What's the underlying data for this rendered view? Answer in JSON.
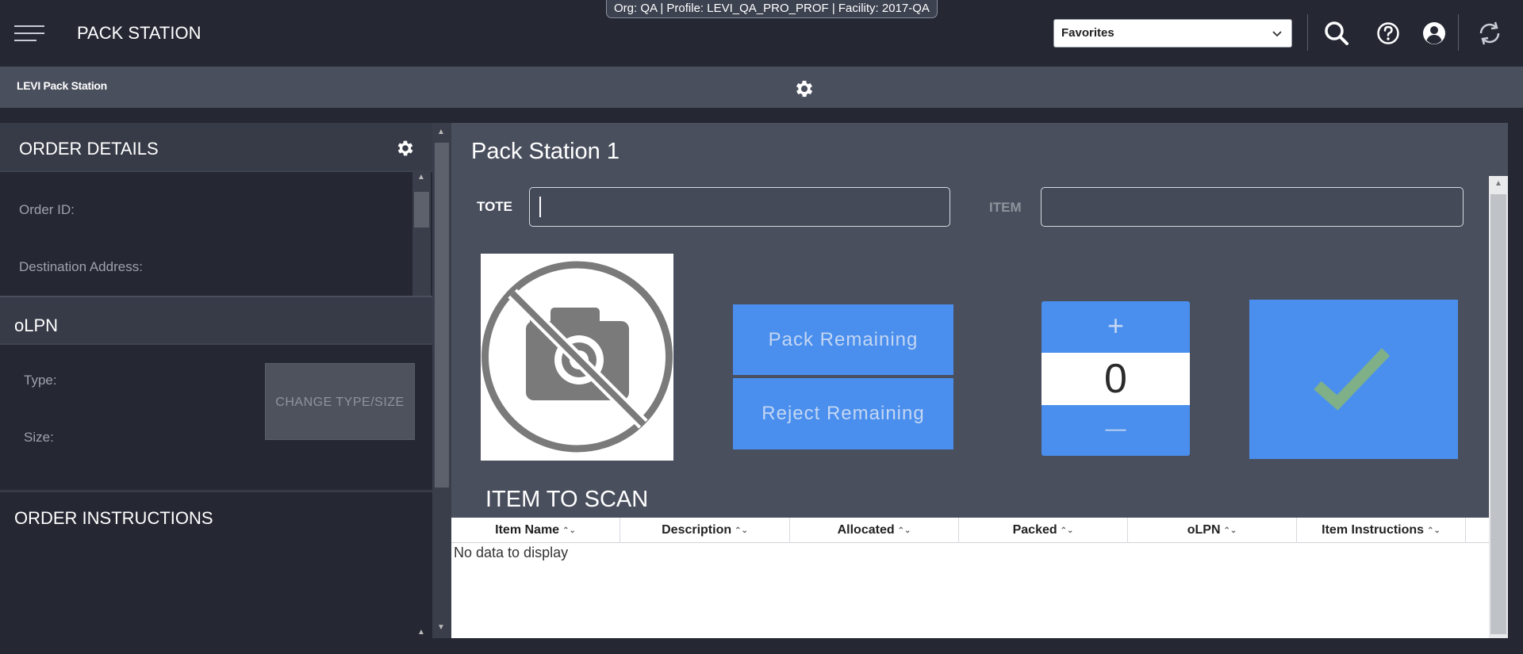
{
  "context_pill": "Org: QA  |  Profile: LEVI_QA_PRO_PROF  |  Facility: 2017-QA",
  "header": {
    "title": "PACK STATION",
    "favorites": {
      "selected": "Favorites"
    }
  },
  "subheader": {
    "title": "LEVI Pack Station"
  },
  "order_details": {
    "title": "ORDER DETAILS",
    "order_id_label": "Order ID:",
    "destination_label": "Destination Address:"
  },
  "olpn": {
    "title": "oLPN",
    "type_label": "Type:",
    "size_label": "Size:",
    "change_button": "CHANGE TYPE/SIZE"
  },
  "order_instructions": {
    "title": "ORDER INSTRUCTIONS"
  },
  "station": {
    "title": "Pack Station 1",
    "tote_label": "TOTE",
    "tote_value": "",
    "item_label": "ITEM",
    "item_value": "",
    "pack_remaining": "Pack Remaining",
    "reject_remaining": "Reject Remaining",
    "quantity": "0",
    "plus": "+",
    "minus": "—"
  },
  "scan_table": {
    "title": "ITEM TO SCAN",
    "columns": [
      "Item Name",
      "Description",
      "Allocated",
      "Packed",
      "oLPN",
      "Item Instructions"
    ],
    "empty_text": "No data to display"
  },
  "colors": {
    "accent_blue": "#4a8fee",
    "checkmark_green": "#7fb088",
    "background_dark": "#252833",
    "panel_gray": "#4a4f5e"
  }
}
